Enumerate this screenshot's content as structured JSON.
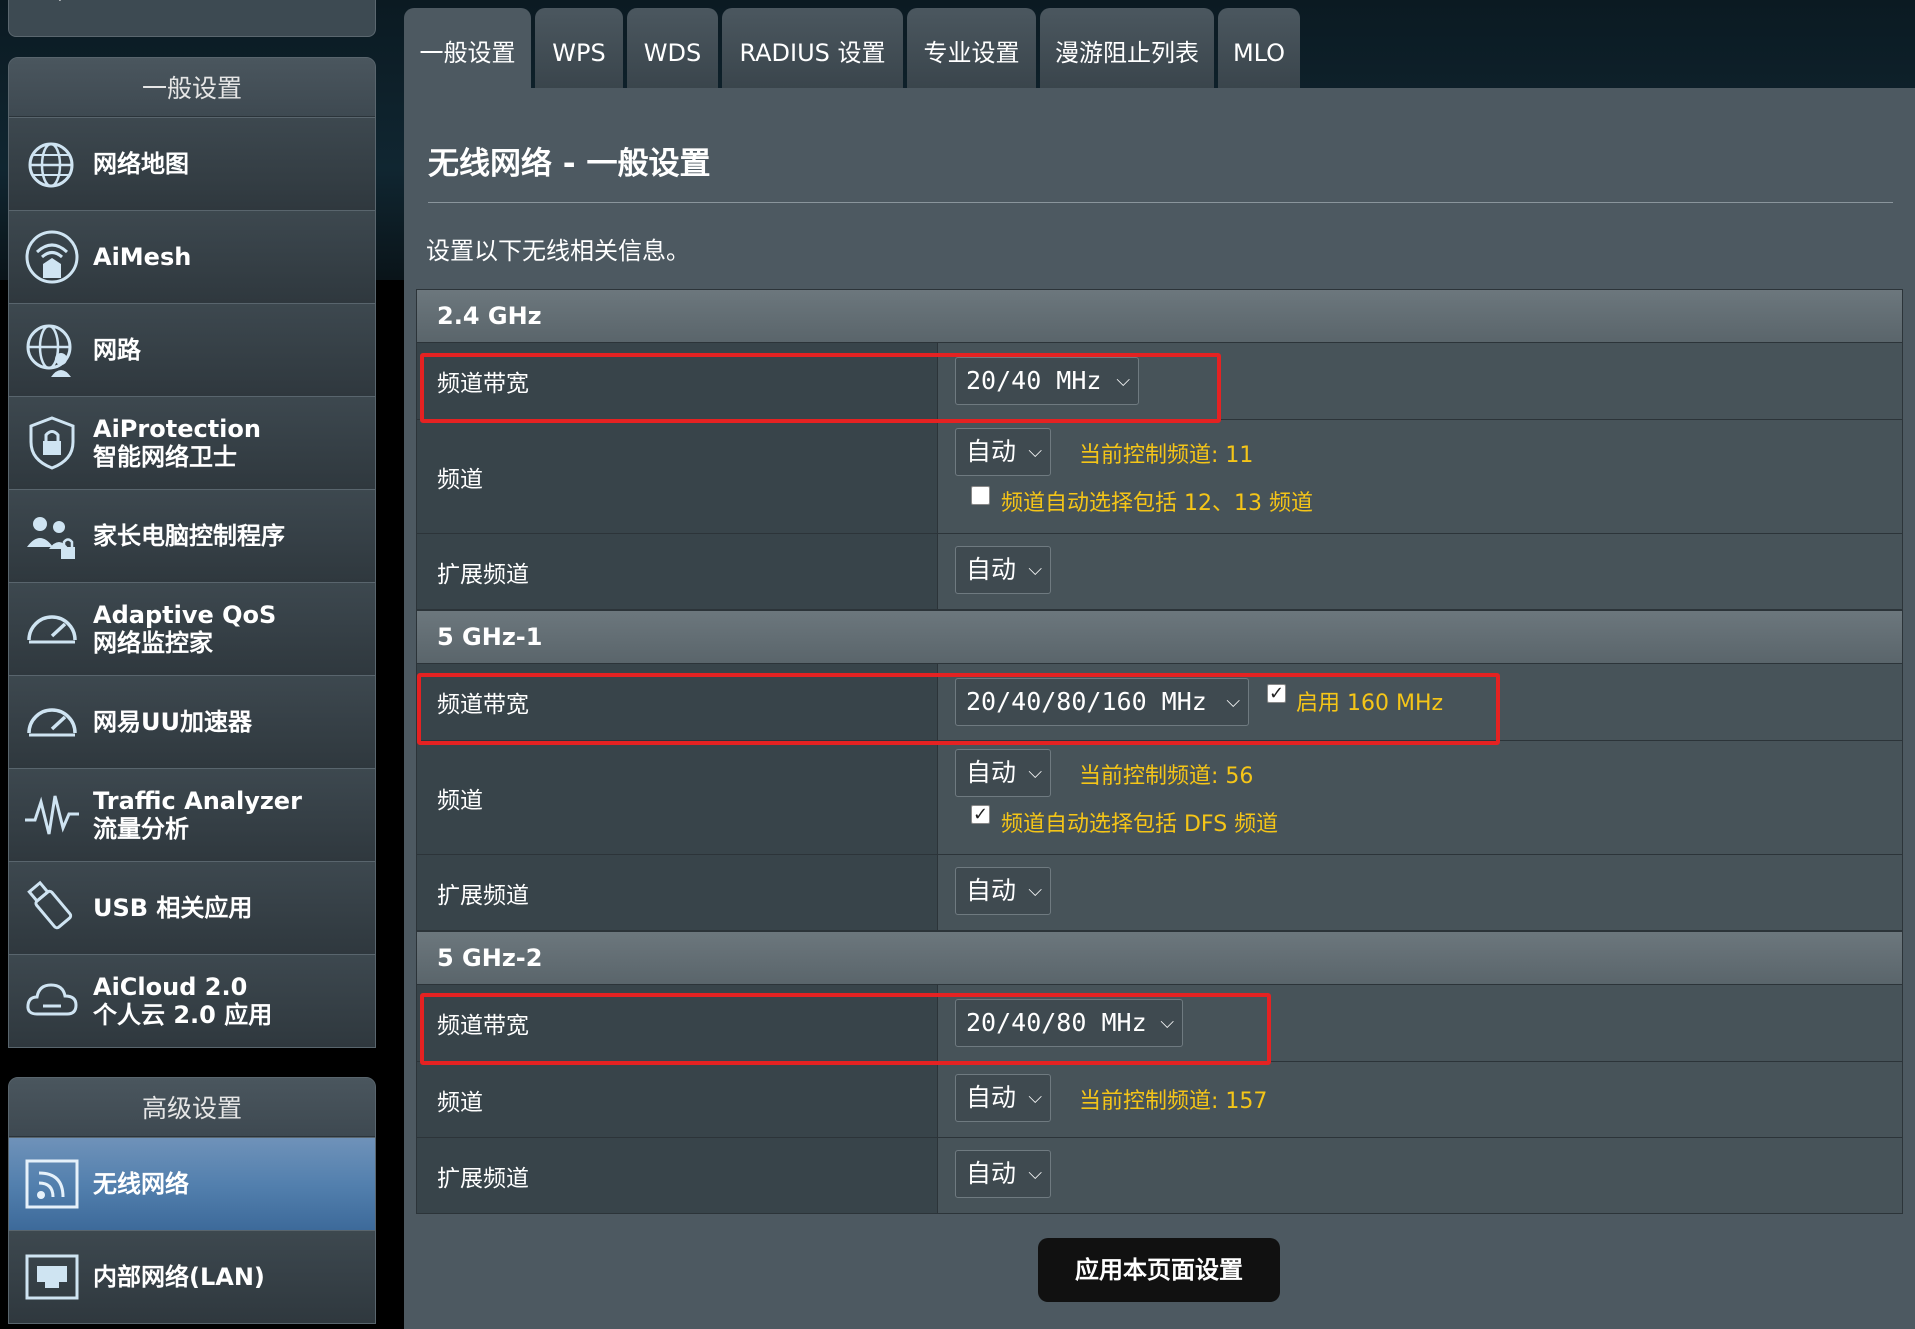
{
  "sidebar": {
    "general_header": "一般设置",
    "advanced_header": "高级设置",
    "general_items": [
      {
        "label": "网络地图",
        "icon": "globe-map-icon"
      },
      {
        "label": "AiMesh",
        "icon": "mesh-router-icon"
      },
      {
        "label": "网路",
        "icon": "globe-person-icon"
      },
      {
        "label": "AiProtection",
        "sublabel": "智能网络卫士",
        "icon": "shield-lock-icon"
      },
      {
        "label": "家长电脑控制程序",
        "icon": "family-lock-icon"
      },
      {
        "label": "Adaptive QoS",
        "sublabel": "网络监控家",
        "icon": "speedometer-icon"
      },
      {
        "label": "网易UU加速器",
        "icon": "speedometer-icon"
      },
      {
        "label": "Traffic Analyzer",
        "sublabel": "流量分析",
        "icon": "pulse-icon"
      },
      {
        "label": "USB 相关应用",
        "icon": "usb-icon"
      },
      {
        "label": "AiCloud 2.0",
        "sublabel": "个人云 2.0 应用",
        "icon": "cloud-icon"
      }
    ],
    "advanced_items": [
      {
        "label": "无线网络",
        "icon": "wireless-icon",
        "active": true
      },
      {
        "label": "内部网络(LAN)",
        "icon": "lan-port-icon"
      }
    ]
  },
  "tabs": [
    "一般设置",
    "WPS",
    "WDS",
    "RADIUS 设置",
    "专业设置",
    "漫游阻止列表",
    "MLO"
  ],
  "active_tab": 0,
  "page": {
    "title": "无线网络 - 一般设置",
    "description": "设置以下无线相关信息。"
  },
  "bands": [
    {
      "name": "2.4 GHz",
      "bandwidth_label": "频道带宽",
      "bandwidth_value": "20/40 MHz",
      "channel_label": "频道",
      "channel_value": "自动",
      "control_channel": "当前控制频道: 11",
      "option_checkbox": {
        "label": "频道自动选择包括 12、13 频道",
        "checked": false
      },
      "ext_label": "扩展频道",
      "ext_value": "自动"
    },
    {
      "name": "5 GHz-1",
      "bandwidth_label": "频道带宽",
      "bandwidth_value": "20/40/80/160 MHz",
      "enable_160": {
        "label": "启用 160 MHz",
        "checked": true
      },
      "channel_label": "频道",
      "channel_value": "自动",
      "control_channel": "当前控制频道: 56",
      "option_checkbox": {
        "label": "频道自动选择包括 DFS 频道",
        "checked": true
      },
      "ext_label": "扩展频道",
      "ext_value": "自动"
    },
    {
      "name": "5 GHz-2",
      "bandwidth_label": "频道带宽",
      "bandwidth_value": "20/40/80 MHz",
      "channel_label": "频道",
      "channel_value": "自动",
      "control_channel": "当前控制频道: 157",
      "ext_label": "扩展频道",
      "ext_value": "自动"
    }
  ],
  "apply_button": "应用本页面设置",
  "colors": {
    "highlight_box": "#e52222",
    "hint_text": "#f5c518",
    "active_sidebar": "#5380ae"
  }
}
